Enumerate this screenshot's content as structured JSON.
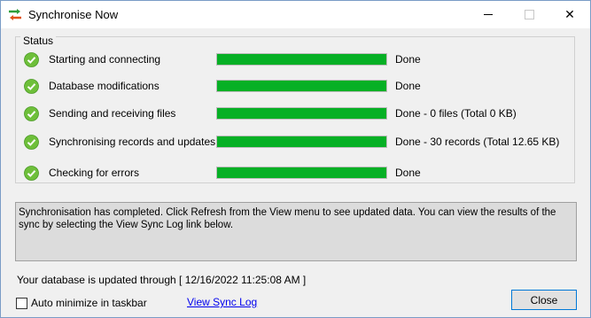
{
  "window": {
    "title": "Synchronise Now",
    "minimize_icon": "minimize-icon",
    "maximize_icon": "maximize-icon",
    "close_glyph": "✕"
  },
  "status": {
    "legend": "Status",
    "items": [
      {
        "label": "Starting and connecting",
        "progress": 1.0,
        "result": "Done"
      },
      {
        "label": "Database modifications",
        "progress": 1.0,
        "result": "Done"
      },
      {
        "label": "Sending and receiving files",
        "progress": 1.0,
        "result": "Done - 0 files (Total 0 KB)"
      },
      {
        "label": "Synchronising records and updates",
        "progress": 1.0,
        "result": "Done - 30 records (Total 12.65 KB)"
      },
      {
        "label": "Checking for errors",
        "progress": 1.0,
        "result": "Done"
      }
    ],
    "colors": {
      "progress": "#06b025",
      "check": "#6ebf3a"
    }
  },
  "message": "Synchronisation has completed.  Click Refresh from the View menu to see updated data.  You can view the results of the sync by selecting the View Sync Log link below.",
  "footer": {
    "updated_text": "Your database is updated through [ 12/16/2022 11:25:08 AM ]",
    "auto_minimize_label": "Auto minimize in taskbar",
    "auto_minimize_checked": false,
    "sync_log_link": "View Sync Log",
    "close_button": "Close"
  }
}
